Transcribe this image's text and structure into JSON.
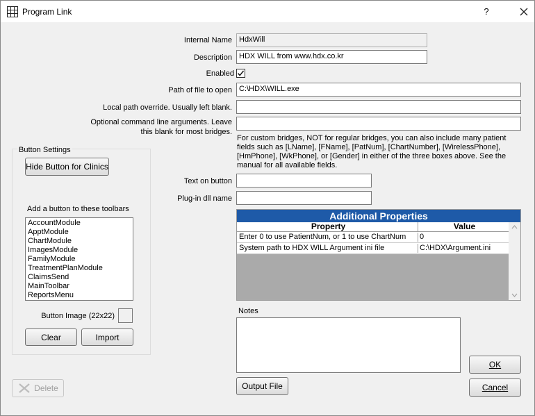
{
  "window": {
    "title": "Program Link",
    "help_label": "?"
  },
  "form": {
    "internal_name_label": "Internal Name",
    "internal_name_value": "HdxWill",
    "description_label": "Description",
    "description_value": "HDX WILL from www.hdx.co.kr",
    "enabled_label": "Enabled",
    "enabled_checked": true,
    "path_label": "Path of file to open",
    "path_value": "C:\\HDX\\WILL.exe",
    "local_path_label": "Local path override.  Usually left blank.",
    "local_path_value": "",
    "cmdline_label": "Optional command line arguments.  Leave this blank for most bridges.",
    "cmdline_value": "",
    "help_text": "For custom bridges, NOT for regular bridges, you can also include many patient fields such as [LName], [FName], [PatNum], [ChartNumber], [WirelessPhone], [HmPhone], [WkPhone], or [Gender] in either of the three boxes above. See the manual for all available fields.",
    "text_on_button_label": "Text on button",
    "text_on_button_value": "",
    "plugin_dll_label": "Plug-in dll name",
    "plugin_dll_value": ""
  },
  "button_settings": {
    "group_title": "Button Settings",
    "hide_button_label": "Hide Button for Clinics",
    "toolbars_label": "Add a button to these toolbars",
    "toolbars": [
      "AccountModule",
      "ApptModule",
      "ChartModule",
      "ImagesModule",
      "FamilyModule",
      "TreatmentPlanModule",
      "ClaimsSend",
      "MainToolbar",
      "ReportsMenu"
    ],
    "button_image_label": "Button Image (22x22)",
    "clear_label": "Clear",
    "import_label": "Import"
  },
  "properties": {
    "title": "Additional Properties",
    "col_property": "Property",
    "col_value": "Value",
    "rows": [
      {
        "property": "Enter 0 to use PatientNum, or 1 to use ChartNum",
        "value": "0"
      },
      {
        "property": "System path to HDX WILL Argument ini file",
        "value": "C:\\HDX\\Argument.ini"
      }
    ],
    "title_color": "#1e5aa8"
  },
  "notes": {
    "label": "Notes",
    "value": ""
  },
  "footer": {
    "delete_label": "Delete",
    "output_file_label": "Output File",
    "ok_label": "OK",
    "cancel_label": "Cancel"
  }
}
